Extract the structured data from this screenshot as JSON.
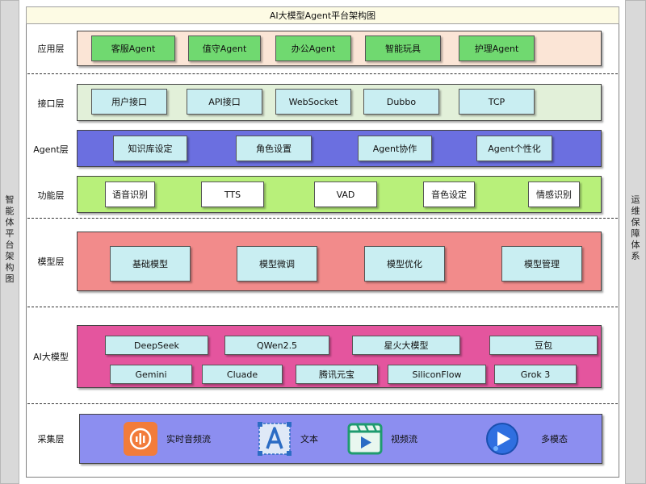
{
  "title": "AI大模型Agent平台架构图",
  "left_side_label": "智能体平台架构图",
  "right_side_label": "运维保障体系",
  "colors": {
    "app_bg": "#fbe5d6",
    "app_btn": "#70d970",
    "iface_bg": "#e2f0d9",
    "iface_btn": "#c9eef2",
    "agent_bg": "#6b6fe0",
    "agent_btn": "#c9eef2",
    "func_bg": "#b8f07a",
    "func_btn": "#ffffff",
    "model_bg": "#f28b8b",
    "model_btn": "#c9eef2",
    "ai_bg": "#e4559e",
    "ai_btn": "#c9eef2",
    "ingest_bg": "#8c8ef0"
  },
  "layers": {
    "application": {
      "label": "应用层",
      "items": [
        "客服Agent",
        "值守Agent",
        "办公Agent",
        "智能玩具",
        "护理Agent"
      ]
    },
    "interface": {
      "label": "接口层",
      "items": [
        "用户接口",
        "API接口",
        "WebSocket",
        "Dubbo",
        "TCP"
      ]
    },
    "agent": {
      "label": "Agent层",
      "items": [
        "知识库设定",
        "角色设置",
        "Agent协作",
        "Agent个性化"
      ]
    },
    "function": {
      "label": "功能层",
      "items": [
        "语音识别",
        "TTS",
        "VAD",
        "音色设定",
        "情感识别"
      ]
    },
    "model": {
      "label": "模型层",
      "items": [
        "基础模型",
        "模型微调",
        "模型优化",
        "模型管理"
      ]
    },
    "ai_models": {
      "label": "AI大模型",
      "row1": [
        "DeepSeek",
        "QWen2.5",
        "星火大模型",
        "豆包"
      ],
      "row2": [
        "Gemini",
        "Cluade",
        "腾讯元宝",
        "SiliconFlow",
        "Grok 3"
      ]
    },
    "ingest": {
      "label": "采集层",
      "items": [
        {
          "label": "实时音频流",
          "icon": "audio-stream-icon"
        },
        {
          "label": "文本",
          "icon": "text-icon"
        },
        {
          "label": "视频流",
          "icon": "video-stream-icon"
        },
        {
          "label": "多模态",
          "icon": "multimodal-icon"
        }
      ]
    }
  }
}
